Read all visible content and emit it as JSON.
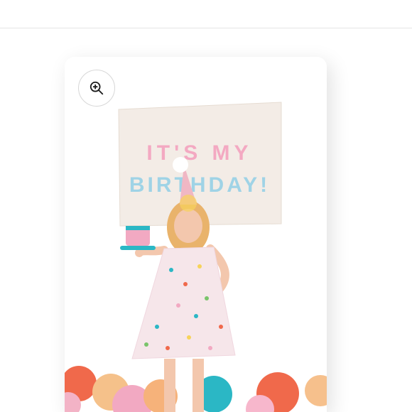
{
  "viewer": {
    "zoom_button_label": "Zoom image",
    "zoom_icon": "zoom-in-icon"
  },
  "photo": {
    "banner_line1": "IT'S MY",
    "banner_line2": "BIRTHDAY!"
  },
  "colors": {
    "border": "#d7d7d7",
    "banner": "#f3ece6",
    "dress_base": "#f6e6ea",
    "hat": "#f0b7c4"
  }
}
